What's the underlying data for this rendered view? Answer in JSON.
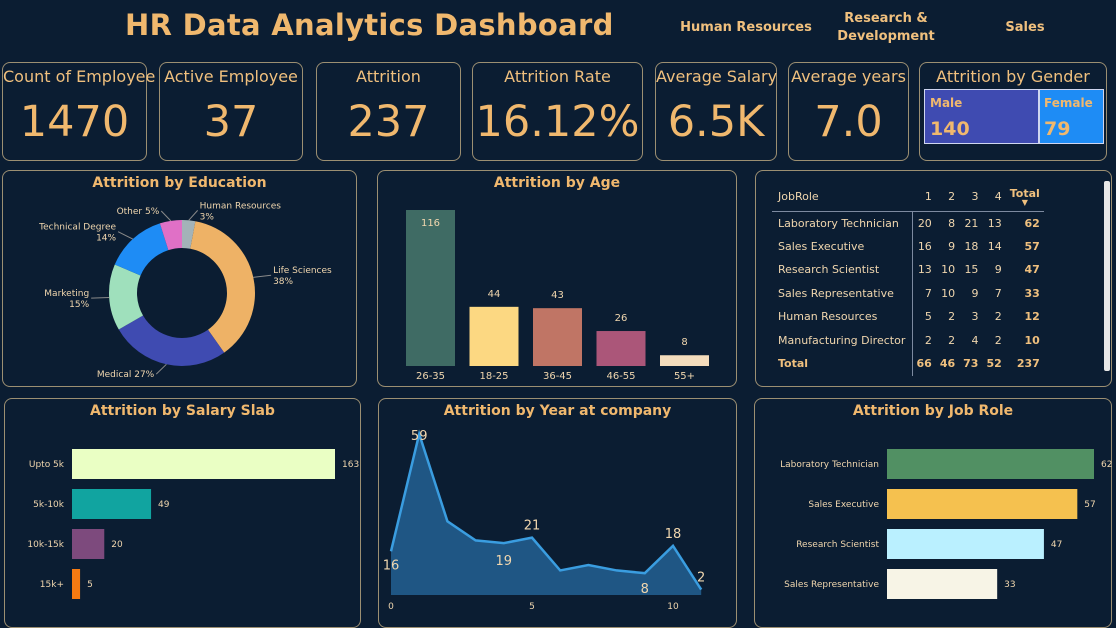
{
  "header": {
    "title": "HR Data Analytics Dashboard",
    "departments": [
      "Human Resources",
      "Research & Development",
      "Sales"
    ]
  },
  "kpis": [
    {
      "label": "Count of Employee",
      "value": "1470"
    },
    {
      "label": "Active Employee",
      "value": "37"
    },
    {
      "label": "Attrition",
      "value": "237"
    },
    {
      "label": "Attrition Rate",
      "value": "16.12%"
    },
    {
      "label": "Average Salary",
      "value": "6.5K"
    },
    {
      "label": "Average years",
      "value": "7.0"
    }
  ],
  "gender": {
    "title": "Attrition by Gender",
    "male_label": "Male",
    "male_value": "140",
    "female_label": "Female",
    "female_value": "79",
    "colors": {
      "male": "#3f4bb1",
      "female": "#1e8cf5"
    }
  },
  "table": {
    "columns": [
      "JobRole",
      "1",
      "2",
      "3",
      "4",
      "Total"
    ],
    "rows": [
      [
        "Laboratory Technician",
        "20",
        "8",
        "21",
        "13",
        "62"
      ],
      [
        "Sales Executive",
        "16",
        "9",
        "18",
        "14",
        "57"
      ],
      [
        "Research Scientist",
        "13",
        "10",
        "15",
        "9",
        "47"
      ],
      [
        "Sales Representative",
        "7",
        "10",
        "9",
        "7",
        "33"
      ],
      [
        "Human Resources",
        "5",
        "2",
        "3",
        "2",
        "12"
      ],
      [
        "Manufacturing Director",
        "2",
        "2",
        "4",
        "2",
        "10"
      ]
    ],
    "total": [
      "Total",
      "66",
      "46",
      "73",
      "52",
      "237"
    ],
    "sort": "Total descending"
  },
  "chart_data": [
    {
      "type": "pie",
      "title": "Attrition by Education",
      "donut": true,
      "categories": [
        "Human Resources",
        "Life Sciences",
        "Medical",
        "Marketing",
        "Technical Degree",
        "Other"
      ],
      "values": [
        3,
        38,
        27,
        15,
        14,
        5
      ],
      "labels": [
        "3%",
        "38%",
        "27%",
        "15%",
        "14%",
        "5%"
      ],
      "colors": [
        "#a3b3b8",
        "#eeb266",
        "#3f4bb1",
        "#9fe0bc",
        "#1e8cf5",
        "#e070c6"
      ]
    },
    {
      "type": "bar",
      "title": "Attrition by Age",
      "orientation": "vertical",
      "categories": [
        "26-35",
        "18-25",
        "36-45",
        "46-55",
        "55+"
      ],
      "values": [
        116,
        44,
        43,
        26,
        8
      ],
      "colors": [
        "#3f6b64",
        "#fcd882",
        "#c07565",
        "#ab5679",
        "#f4dcbc"
      ]
    },
    {
      "type": "bar",
      "title": "Attrition by Salary Slab",
      "orientation": "horizontal",
      "categories": [
        "Upto 5k",
        "5k-10k",
        "10k-15k",
        "15k+"
      ],
      "values": [
        163,
        49,
        20,
        5
      ],
      "colors": [
        "#eaffc4",
        "#11a4a0",
        "#7d4a7d",
        "#f57a12"
      ]
    },
    {
      "type": "area",
      "title": "Attrition by Year at company",
      "x": [
        0,
        1,
        2,
        3,
        4,
        5,
        6,
        7,
        8,
        9,
        10,
        11
      ],
      "y": [
        16,
        59,
        27,
        20,
        19,
        21,
        9,
        11,
        9,
        8,
        18,
        2
      ],
      "labeled_points": {
        "0": "16",
        "1": "59",
        "4": "19",
        "5": "21",
        "9": "8",
        "10": "18",
        "11": "2"
      },
      "xticks": [
        0,
        5,
        10
      ],
      "color": "#3a9de0"
    },
    {
      "type": "bar",
      "title": "Attrition by Job Role",
      "orientation": "horizontal",
      "categories": [
        "Laboratory Technician",
        "Sales Executive",
        "Research Scientist",
        "Sales Representative"
      ],
      "values": [
        62,
        57,
        47,
        33
      ],
      "colors": [
        "#519063",
        "#f5c14f",
        "#baf0ff",
        "#f7f4e6"
      ]
    }
  ]
}
